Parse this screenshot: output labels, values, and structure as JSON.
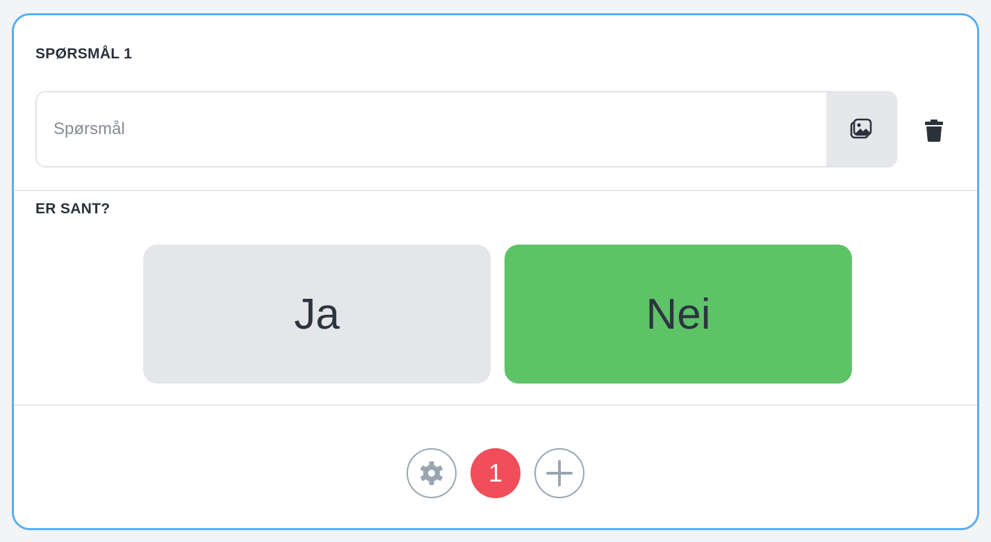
{
  "question_section": {
    "label": "SPØRSMÅL 1",
    "input_placeholder": "Spørsmål",
    "input_value": "",
    "image_icon": "image-icon",
    "delete_icon": "trash-icon"
  },
  "truth_section": {
    "label": "ER SANT?",
    "options": [
      {
        "label": "Ja",
        "selected": false,
        "color": "#e5e6e9"
      },
      {
        "label": "Nei",
        "selected": true,
        "color": "#5ec367"
      }
    ]
  },
  "footer": {
    "settings_icon": "gear-icon",
    "question_number": "1",
    "question_number_color": "#ef4e5a",
    "add_icon": "plus-icon"
  },
  "colors": {
    "card_border": "#5aaef0",
    "selected_answer": "#5ec367"
  }
}
